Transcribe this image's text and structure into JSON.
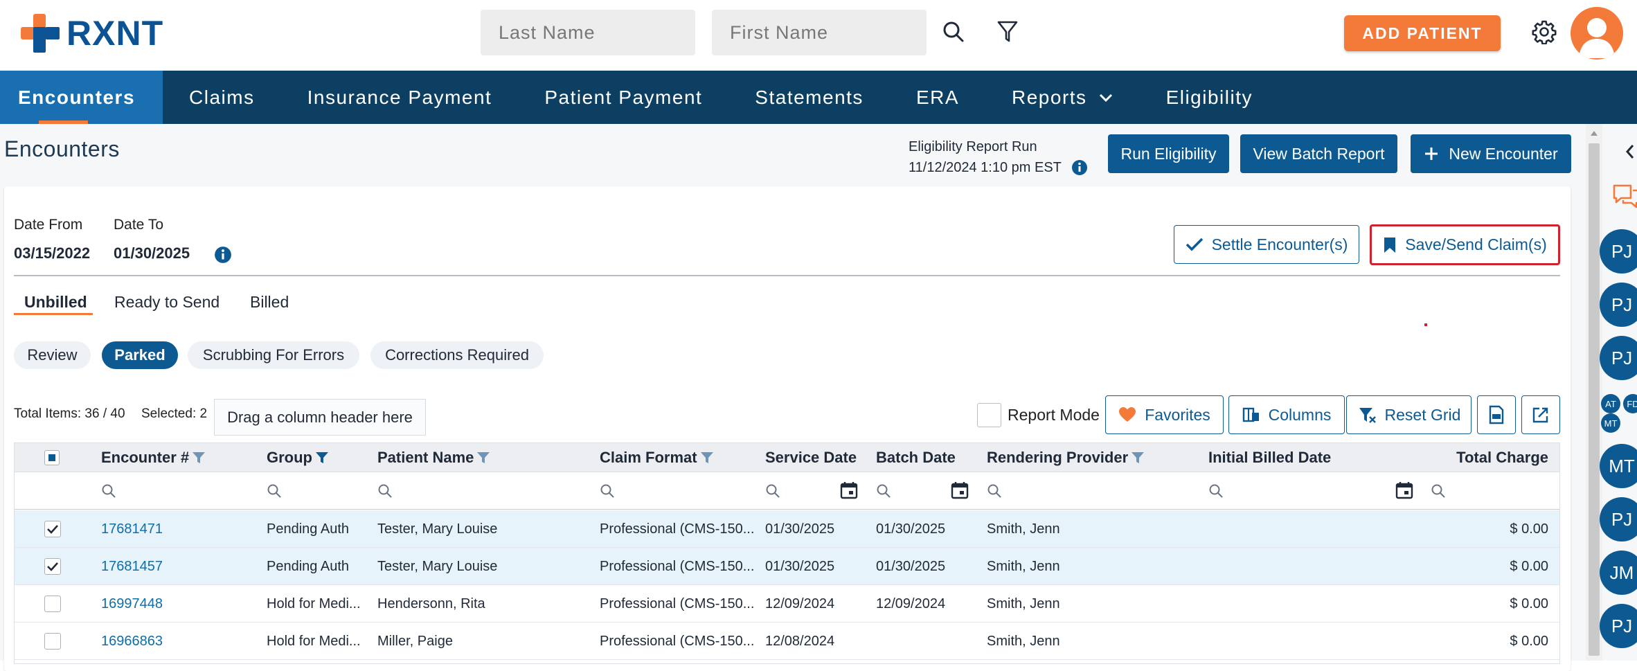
{
  "brand": {
    "name": "RXNT"
  },
  "search": {
    "last_name_placeholder": "Last Name",
    "first_name_placeholder": "First Name"
  },
  "header": {
    "add_patient": "ADD PATIENT"
  },
  "nav": {
    "items": [
      "Encounters",
      "Claims",
      "Insurance Payment",
      "Patient Payment",
      "Statements",
      "ERA",
      "Reports",
      "Eligibility"
    ]
  },
  "page": {
    "title": "Encounters",
    "eligibility_label": "Eligibility Report Run",
    "eligibility_time": "11/12/2024 1:10 pm EST",
    "run_eligibility": "Run Eligibility",
    "view_batch_report": "View Batch Report",
    "new_encounter": "New Encounter"
  },
  "filters": {
    "date_from_label": "Date From",
    "date_from": "03/15/2022",
    "date_to_label": "Date To",
    "date_to": "01/30/2025",
    "settle": "Settle Encounter(s)",
    "save_send": "Save/Send Claim(s)"
  },
  "tabs": [
    "Unbilled",
    "Ready to Send",
    "Billed"
  ],
  "pills": [
    "Review",
    "Parked",
    "Scrubbing For Errors",
    "Corrections Required"
  ],
  "toolbar": {
    "total": "Total Items: 36 / 40",
    "selected": "Selected: 2",
    "drag_hint": "Drag a column header here",
    "report_mode": "Report Mode",
    "favorites": "Favorites",
    "columns": "Columns",
    "reset_grid": "Reset Grid"
  },
  "grid": {
    "headers": [
      "Encounter #",
      "Group",
      "Patient Name",
      "Claim Format",
      "Service Date",
      "Batch Date",
      "Rendering Provider",
      "Initial Billed Date",
      "Total Charge"
    ],
    "rows": [
      {
        "checked": true,
        "enc": "17681471",
        "group": "Pending Auth",
        "patient": "Tester, Mary Louise",
        "format": "Professional (CMS-150...",
        "service": "01/30/2025",
        "batch": "01/30/2025",
        "provider": "Smith, Jenn",
        "billed": "",
        "charge": "$ 0.00"
      },
      {
        "checked": true,
        "enc": "17681457",
        "group": "Pending Auth",
        "patient": "Tester, Mary Louise",
        "format": "Professional (CMS-150...",
        "service": "01/30/2025",
        "batch": "01/30/2025",
        "provider": "Smith, Jenn",
        "billed": "",
        "charge": "$ 0.00"
      },
      {
        "checked": false,
        "enc": "16997448",
        "group": "Hold for Medi...",
        "patient": "Hendersonn, Rita",
        "format": "Professional (CMS-150...",
        "service": "12/09/2024",
        "batch": "12/09/2024",
        "provider": "Smith, Jenn",
        "billed": "",
        "charge": "$ 0.00"
      },
      {
        "checked": false,
        "enc": "16966863",
        "group": "Hold for Medi...",
        "patient": "Miller, Paige",
        "format": "Professional (CMS-150...",
        "service": "12/08/2024",
        "batch": "",
        "provider": "Smith, Jenn",
        "billed": "",
        "charge": "$ 0.00"
      }
    ]
  },
  "rail": {
    "avatars": [
      "PJ",
      "PJ",
      "PJ",
      "MT",
      "PJ",
      "JM",
      "PJ"
    ],
    "mini": [
      "AT",
      "FD",
      "MT"
    ]
  },
  "colors": {
    "brand_blue": "#0d3f63",
    "accent_orange": "#f47a3a",
    "button_blue": "#0d5a93",
    "highlight_red": "#d0212e"
  }
}
